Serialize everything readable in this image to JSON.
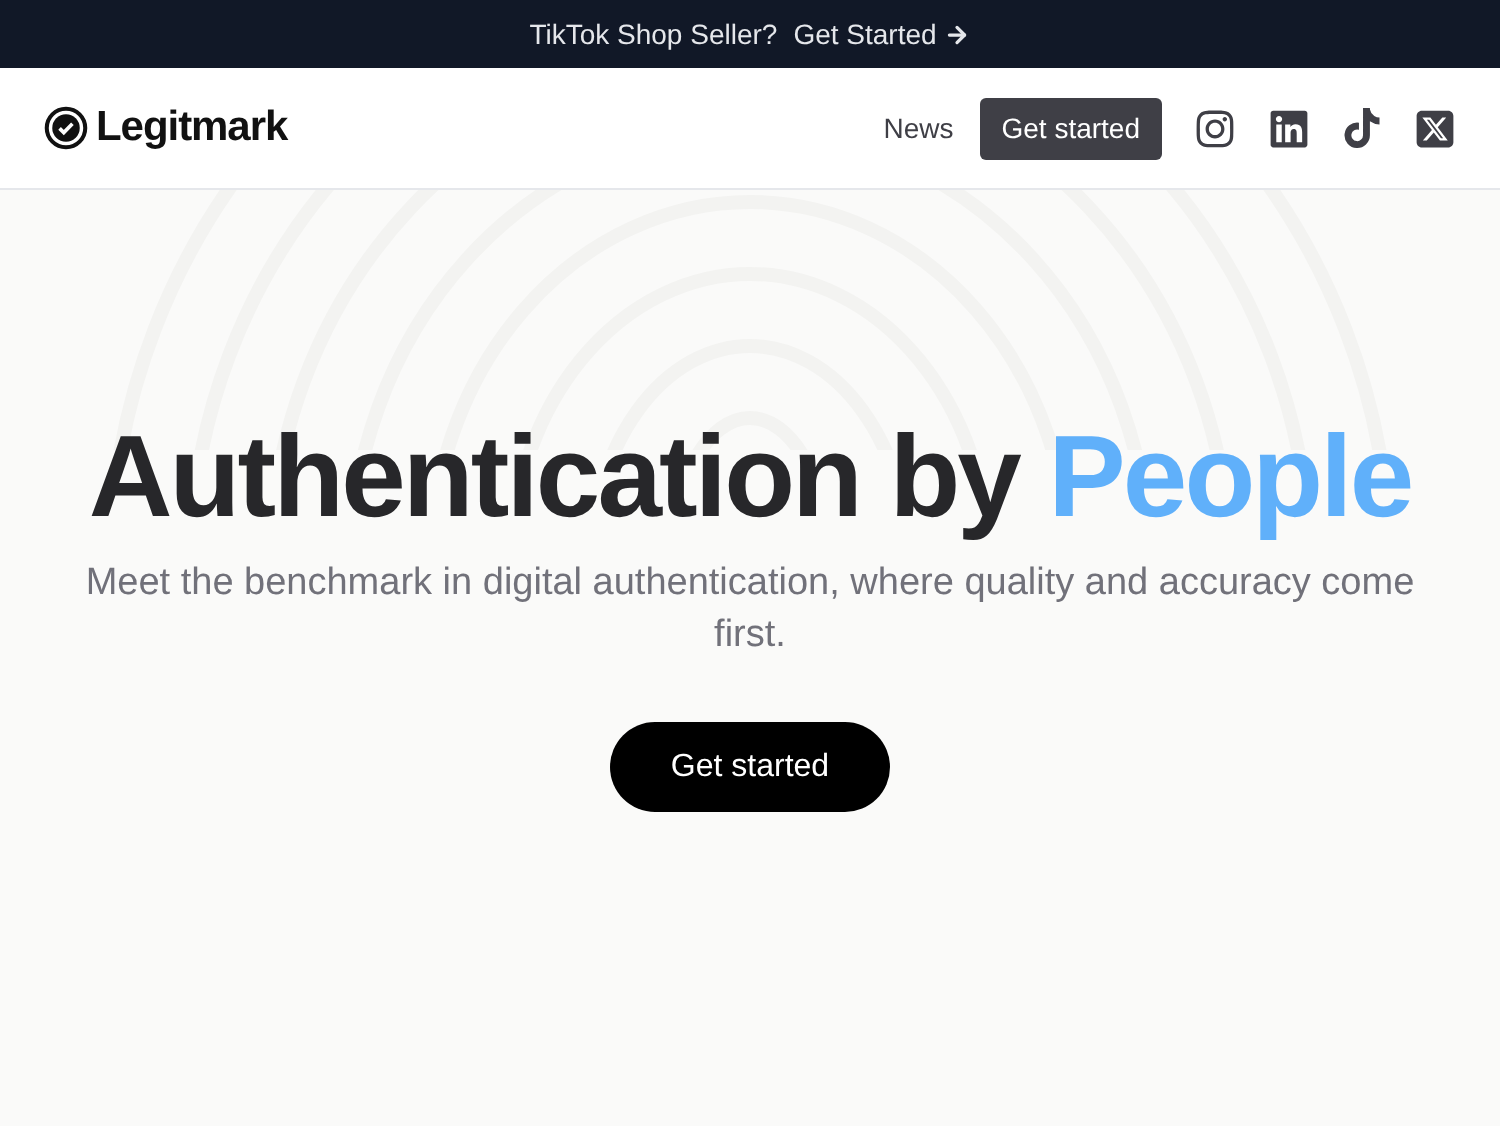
{
  "banner": {
    "text": "TikTok Shop Seller?",
    "link": "Get Started"
  },
  "header": {
    "logo": "Legitmark",
    "nav": [
      {
        "label": "News",
        "kind": "link"
      },
      {
        "label": "Get started",
        "kind": "button"
      }
    ]
  },
  "hero": {
    "title": "Authentication by",
    "title_highlight": "People",
    "subtitle": "Meet the benchmark in digital authentication, where quality and accuracy come first.",
    "cta": "Get started"
  }
}
